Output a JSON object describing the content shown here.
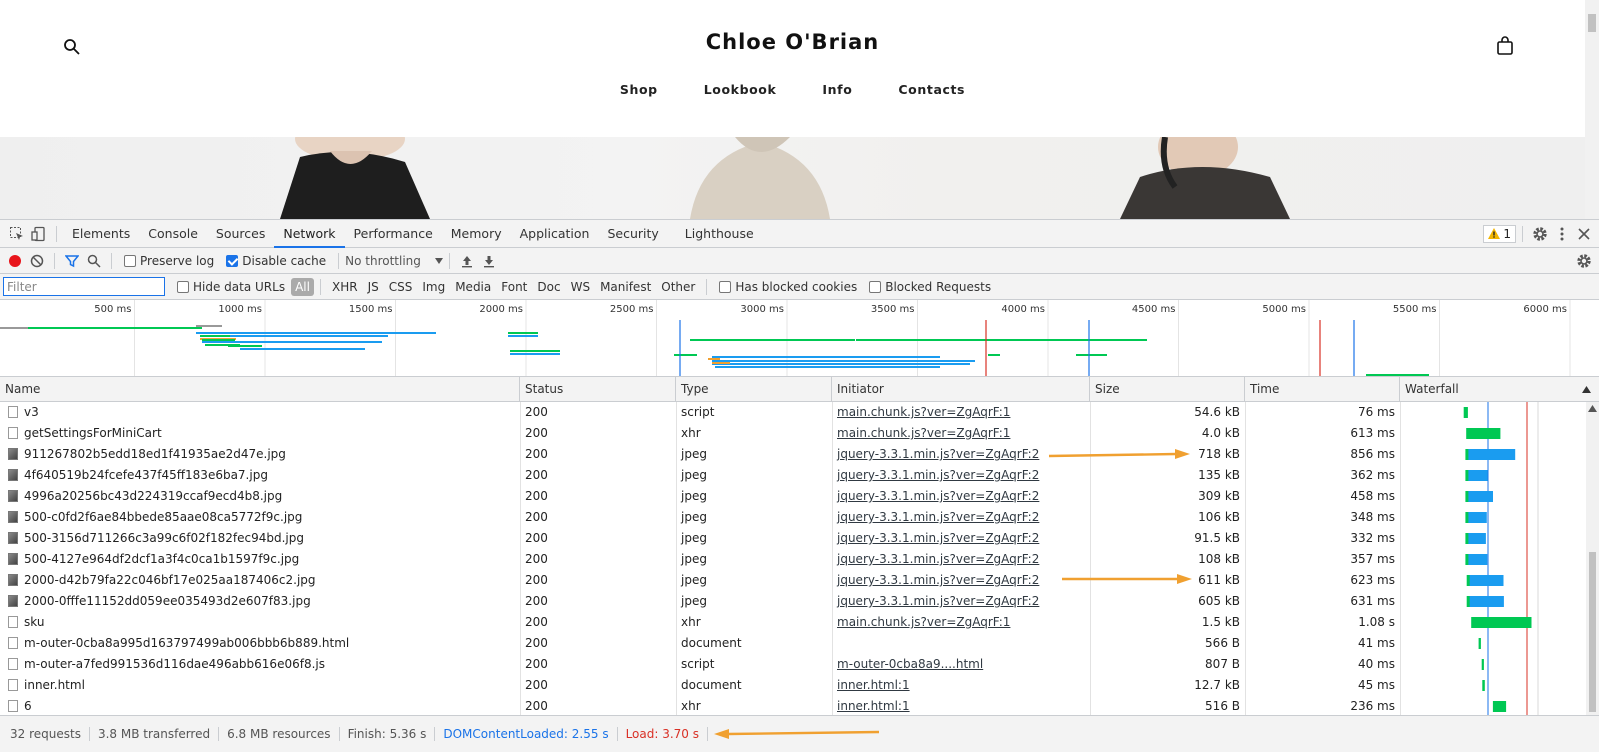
{
  "site": {
    "title": "Chloe O'Brian",
    "nav": [
      "Shop",
      "Lookbook",
      "Info",
      "Contacts"
    ]
  },
  "devtools": {
    "tabs": [
      "Elements",
      "Console",
      "Sources",
      "Network",
      "Performance",
      "Memory",
      "Application",
      "Security",
      "Lighthouse"
    ],
    "active_tab": "Network",
    "warning_count": "1",
    "toolbar": {
      "preserve_log": "Preserve log",
      "disable_cache": "Disable cache",
      "throttling": "No throttling"
    },
    "filterbar": {
      "filter_placeholder": "Filter",
      "hide_data_urls": "Hide data URLs",
      "types": [
        "All",
        "XHR",
        "JS",
        "CSS",
        "Img",
        "Media",
        "Font",
        "Doc",
        "WS",
        "Manifest",
        "Other"
      ],
      "has_blocked_cookies": "Has blocked cookies",
      "blocked_requests": "Blocked Requests"
    },
    "overview_ticks": [
      "500 ms",
      "1000 ms",
      "1500 ms",
      "2000 ms",
      "2500 ms",
      "3000 ms",
      "3500 ms",
      "4000 ms",
      "4500 ms",
      "5000 ms",
      "5500 ms",
      "6000 ms"
    ],
    "columns": [
      "Name",
      "Status",
      "Type",
      "Initiator",
      "Size",
      "Time",
      "Waterfall"
    ],
    "rows": [
      {
        "name": "v3",
        "status": "200",
        "type": "script",
        "initiator": "main.chunk.js?ver=ZgAqrF:1",
        "size": "54.6 kB",
        "time": "76 ms",
        "icon": "doc"
      },
      {
        "name": "getSettingsForMiniCart",
        "status": "200",
        "type": "xhr",
        "initiator": "main.chunk.js?ver=ZgAqrF:1",
        "size": "4.0 kB",
        "time": "613 ms",
        "icon": "doc"
      },
      {
        "name": "911267802b5edd18ed1f41935ae2d47e.jpg",
        "status": "200",
        "type": "jpeg",
        "initiator": "jquery-3.3.1.min.js?ver=ZgAqrF:2",
        "size": "718 kB",
        "time": "856 ms",
        "icon": "img"
      },
      {
        "name": "4f640519b24fcefe437f45ff183e6ba7.jpg",
        "status": "200",
        "type": "jpeg",
        "initiator": "jquery-3.3.1.min.js?ver=ZgAqrF:2",
        "size": "135 kB",
        "time": "362 ms",
        "icon": "img"
      },
      {
        "name": "4996a20256bc43d224319ccaf9ecd4b8.jpg",
        "status": "200",
        "type": "jpeg",
        "initiator": "jquery-3.3.1.min.js?ver=ZgAqrF:2",
        "size": "309 kB",
        "time": "458 ms",
        "icon": "img"
      },
      {
        "name": "500-c0fd2f6ae84bbede85aae08ca5772f9c.jpg",
        "status": "200",
        "type": "jpeg",
        "initiator": "jquery-3.3.1.min.js?ver=ZgAqrF:2",
        "size": "106 kB",
        "time": "348 ms",
        "icon": "img"
      },
      {
        "name": "500-3156d711266c3a99c6f02f182fec94bd.jpg",
        "status": "200",
        "type": "jpeg",
        "initiator": "jquery-3.3.1.min.js?ver=ZgAqrF:2",
        "size": "91.5 kB",
        "time": "332 ms",
        "icon": "img"
      },
      {
        "name": "500-4127e964df2dcf1a3f4c0ca1b1597f9c.jpg",
        "status": "200",
        "type": "jpeg",
        "initiator": "jquery-3.3.1.min.js?ver=ZgAqrF:2",
        "size": "108 kB",
        "time": "357 ms",
        "icon": "img"
      },
      {
        "name": "2000-d42b79fa22c046bf17e025aa187406c2.jpg",
        "status": "200",
        "type": "jpeg",
        "initiator": "jquery-3.3.1.min.js?ver=ZgAqrF:2",
        "size": "611 kB",
        "time": "623 ms",
        "icon": "img"
      },
      {
        "name": "2000-0fffe11152dd059ee035493d2e607f83.jpg",
        "status": "200",
        "type": "jpeg",
        "initiator": "jquery-3.3.1.min.js?ver=ZgAqrF:2",
        "size": "605 kB",
        "time": "631 ms",
        "icon": "img"
      },
      {
        "name": "sku",
        "status": "200",
        "type": "xhr",
        "initiator": "main.chunk.js?ver=ZgAqrF:1",
        "size": "1.5 kB",
        "time": "1.08 s",
        "icon": "doc"
      },
      {
        "name": "m-outer-0cba8a995d163797499ab006bbb6b889.html",
        "status": "200",
        "type": "document",
        "initiator": "",
        "size": "566 B",
        "time": "41 ms",
        "icon": "doc"
      },
      {
        "name": "m-outer-a7fed991536d116dae496abb616e06f8.js",
        "status": "200",
        "type": "script",
        "initiator": "m-outer-0cba8a9....html",
        "size": "807 B",
        "time": "40 ms",
        "icon": "doc"
      },
      {
        "name": "inner.html",
        "status": "200",
        "type": "document",
        "initiator": "inner.html:1",
        "size": "12.7 kB",
        "time": "45 ms",
        "icon": "doc"
      },
      {
        "name": "6",
        "status": "200",
        "type": "xhr",
        "initiator": "inner.html:1",
        "size": "516 B",
        "time": "236 ms",
        "icon": "doc"
      }
    ],
    "status": {
      "requests": "32 requests",
      "transferred": "3.8 MB transferred",
      "resources": "6.8 MB resources",
      "finish": "Finish: 5.36 s",
      "dcl": "DOMContentLoaded: 2.55 s",
      "load": "Load: 3.70 s"
    },
    "colors": {
      "accent": "#1a73e8",
      "dcl": "#1a73e8",
      "load": "#d93025",
      "annotation_arrow": "#f0a030",
      "waiting": "#00c853",
      "download": "#1a9cf0"
    }
  }
}
